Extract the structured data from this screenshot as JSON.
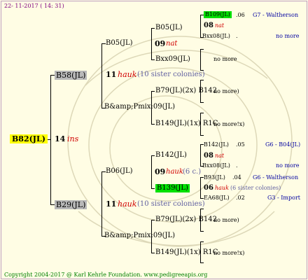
{
  "header_date": "22- 11-2017 ( 14: 31)",
  "footer": "Copyright 2004-2017 @ Karl Kehrle Foundation.   www.pedigreeapis.org",
  "root": {
    "name": "B82(JL)",
    "num": "14",
    "note": "ins"
  },
  "top": {
    "name": "B58(JL)",
    "num": "11",
    "note": "hauk",
    "sub": "(10 sister colonies)",
    "upper": {
      "name": "B05(JL)",
      "num": "09",
      "note": "nat",
      "a": {
        "name": "B05(JL)",
        "a": {
          "name": "B109(JL)",
          "year": ".06",
          "breeder": "G7 - Waltherson"
        },
        "b": {
          "num": "08",
          "note": "nat"
        },
        "c": {
          "name": "Bxx08(JL)",
          "year": ".",
          "breeder": "no more"
        }
      },
      "b": {
        "name": "Bxx09(JL)",
        "more": "no more"
      }
    },
    "lower": {
      "name": "B&amp;Pmix:09(JL)",
      "a": {
        "name": "B79(JL)(2x) B142",
        "more": "no more)"
      },
      "b": {
        "name": "B149(JL)(1x) R1C",
        "more": "no more!x)"
      }
    }
  },
  "bottom": {
    "name": "B29(JL)",
    "num": "11",
    "note": "hauk",
    "sub": "(10 sister colonies)",
    "upper": {
      "name": "B06(JL)",
      "num": "09",
      "note": "hauk",
      "sub": "(6 c.)",
      "a": {
        "name": "B142(JL)",
        "a": {
          "name": "B142(JL)",
          "year": ".05",
          "breeder": "G6 - B04(JL)"
        },
        "b": {
          "num": "08",
          "note": "nat"
        },
        "c": {
          "name": "Bxx08(JL)",
          "year": ".",
          "breeder": "no more"
        }
      },
      "b": {
        "name": "B139(JL)",
        "a": {
          "name": "B93(JL)",
          "year": ".04",
          "breeder": "G6 - Waltherson"
        },
        "b": {
          "num": "06",
          "note": "hauk",
          "sub": "(6 sister colonies)"
        },
        "c": {
          "name": "EA68(JL)",
          "year": ".02",
          "breeder": "G3 - Import"
        }
      }
    },
    "lower": {
      "name": "B&amp;Pmix:09(JL)",
      "a": {
        "name": "B79(JL)(2x) B142",
        "more": "no more)"
      },
      "b": {
        "name": "B149(JL)(1x) R1C",
        "more": "no more!x)"
      }
    }
  }
}
